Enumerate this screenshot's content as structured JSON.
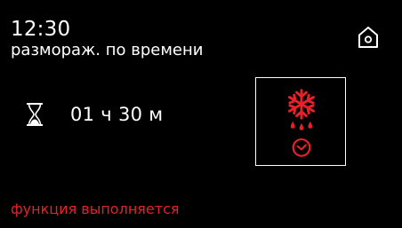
{
  "header": {
    "time": "12:30",
    "mode_name": "размораж. по времени"
  },
  "timer": {
    "icon": "hourglass-icon",
    "value": "01 ч 30 м"
  },
  "program": {
    "icon": "snowflake-with-drops-and-timer-icon"
  },
  "status": {
    "text": "функция выполняется"
  },
  "colors": {
    "background": "#000000",
    "text": "#ffffff",
    "accent_red": "#e8202a"
  },
  "icons": {
    "home": "home-icon"
  }
}
